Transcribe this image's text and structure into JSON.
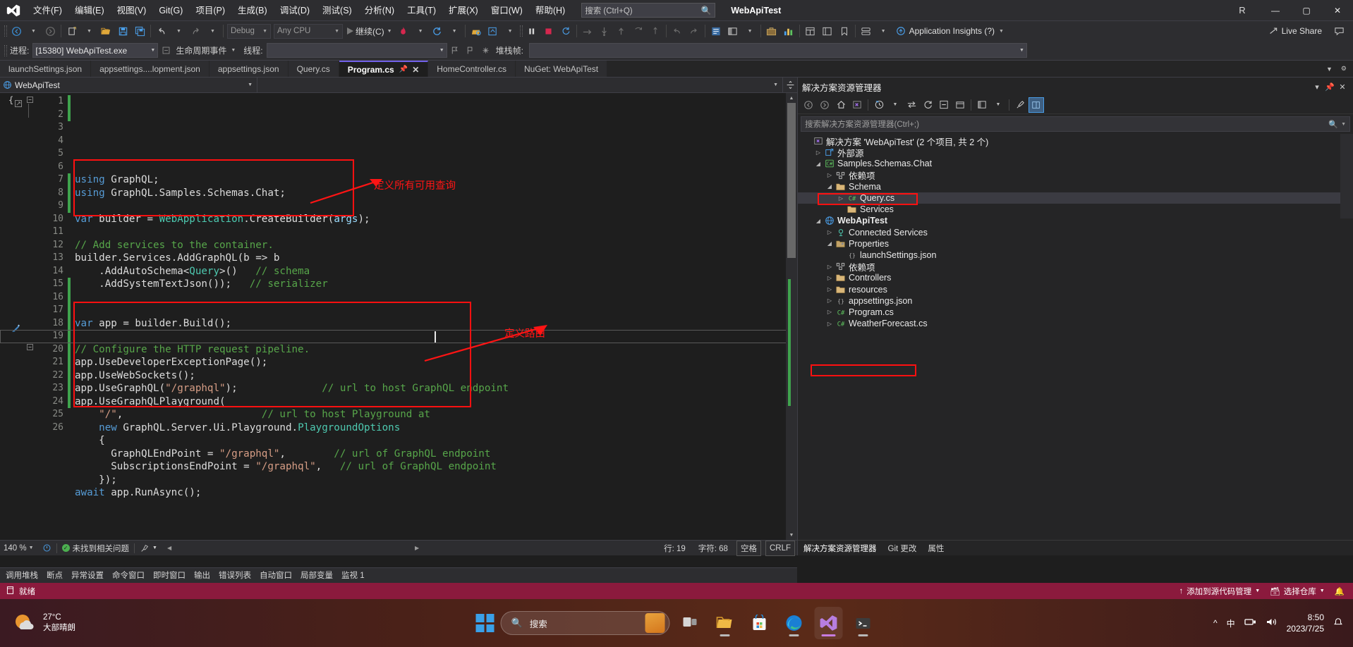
{
  "titlebar": {
    "menus": [
      "文件(F)",
      "编辑(E)",
      "视图(V)",
      "Git(G)",
      "项目(P)",
      "生成(B)",
      "调试(D)",
      "测试(S)",
      "分析(N)",
      "工具(T)",
      "扩展(X)",
      "窗口(W)",
      "帮助(H)"
    ],
    "search_placeholder": "搜索 (Ctrl+Q)",
    "project_name": "WebApiTest",
    "account_initial": "R",
    "minimize": "—",
    "maximize": "▢",
    "close": "✕"
  },
  "toolbar": {
    "config": "Debug",
    "platform": "Any CPU",
    "run_label": "继续(C)",
    "ai_label": "Application Insights (?)",
    "live_share": "Live Share"
  },
  "debugbar": {
    "process_label": "进程:",
    "process_value": "[15380] WebApiTest.exe",
    "lifecycle_label": "生命周期事件",
    "thread_label": "线程:",
    "thread_value": "",
    "stack_label": "堆栈帧:",
    "stack_value": ""
  },
  "tabs": [
    {
      "label": "launchSettings.json",
      "active": false
    },
    {
      "label": "appsettings....lopment.json",
      "active": false
    },
    {
      "label": "appsettings.json",
      "active": false
    },
    {
      "label": "Query.cs",
      "active": false
    },
    {
      "label": "Program.cs",
      "active": true
    },
    {
      "label": "HomeController.cs",
      "active": false
    },
    {
      "label": "NuGet: WebApiTest",
      "active": false
    }
  ],
  "navbar": {
    "scope": "WebApiTest"
  },
  "editor": {
    "line_numbers": [
      "1",
      "2",
      "3",
      "4",
      "5",
      "6",
      "7",
      "8",
      "9",
      "10",
      "11",
      "12",
      "13",
      "14",
      "15",
      "16",
      "17",
      "18",
      "19",
      "20",
      "21",
      "22",
      "23",
      "24",
      "25",
      "26"
    ],
    "lines": [
      [
        {
          "t": "using ",
          "c": "kw"
        },
        {
          "t": "GraphQL;",
          "c": "txt"
        }
      ],
      [
        {
          "t": "using ",
          "c": "kw"
        },
        {
          "t": "GraphQL.Samples.Schemas.Chat;",
          "c": "txt"
        }
      ],
      [],
      [
        {
          "t": "var ",
          "c": "kw"
        },
        {
          "t": "builder = ",
          "c": "txt"
        },
        {
          "t": "WebApplication",
          "c": "type"
        },
        {
          "t": ".CreateBuilder(",
          "c": "txt"
        },
        {
          "t": "args",
          "c": "par"
        },
        {
          "t": ");",
          "c": "txt"
        }
      ],
      [],
      [
        {
          "t": "// Add services to the container.",
          "c": "cmt"
        }
      ],
      [
        {
          "t": "builder.Services.AddGraphQL(b => b",
          "c": "txt"
        }
      ],
      [
        {
          "t": "    .AddAutoSchema<",
          "c": "txt"
        },
        {
          "t": "Query",
          "c": "type"
        },
        {
          "t": ">()   ",
          "c": "txt"
        },
        {
          "t": "// schema",
          "c": "cmt"
        }
      ],
      [
        {
          "t": "    .AddSystemTextJson());   ",
          "c": "txt"
        },
        {
          "t": "// serializer",
          "c": "cmt"
        }
      ],
      [],
      [],
      [
        {
          "t": "var ",
          "c": "kw"
        },
        {
          "t": "app = builder.Build();",
          "c": "txt"
        }
      ],
      [],
      [
        {
          "t": "// Configure the HTTP request pipeline.",
          "c": "cmt"
        }
      ],
      [
        {
          "t": "app.UseDeveloperExceptionPage();",
          "c": "txt"
        }
      ],
      [
        {
          "t": "app.UseWebSockets();",
          "c": "txt"
        }
      ],
      [
        {
          "t": "app.UseGraphQL(",
          "c": "txt"
        },
        {
          "t": "\"/graphql\"",
          "c": "str"
        },
        {
          "t": ");              ",
          "c": "txt"
        },
        {
          "t": "// url to host GraphQL endpoint",
          "c": "cmt"
        }
      ],
      [
        {
          "t": "app.UseGraphQLPlayground(",
          "c": "txt"
        }
      ],
      [
        {
          "t": "    ",
          "c": "txt"
        },
        {
          "t": "\"/\"",
          "c": "str"
        },
        {
          "t": ",                       ",
          "c": "txt"
        },
        {
          "t": "// url to host Playground at",
          "c": "cmt"
        }
      ],
      [
        {
          "t": "    ",
          "c": "txt"
        },
        {
          "t": "new ",
          "c": "kw"
        },
        {
          "t": "GraphQL.Server.Ui.Playground.",
          "c": "txt"
        },
        {
          "t": "PlaygroundOptions",
          "c": "type"
        }
      ],
      [
        {
          "t": "    {",
          "c": "txt"
        }
      ],
      [
        {
          "t": "      GraphQLEndPoint = ",
          "c": "txt"
        },
        {
          "t": "\"/graphql\"",
          "c": "str"
        },
        {
          "t": ",        ",
          "c": "txt"
        },
        {
          "t": "// url of GraphQL endpoint",
          "c": "cmt"
        }
      ],
      [
        {
          "t": "      SubscriptionsEndPoint = ",
          "c": "txt"
        },
        {
          "t": "\"/graphql\"",
          "c": "str"
        },
        {
          "t": ",   ",
          "c": "txt"
        },
        {
          "t": "// url of GraphQL endpoint",
          "c": "cmt"
        }
      ],
      [
        {
          "t": "    });",
          "c": "txt"
        }
      ],
      [
        {
          "t": "await ",
          "c": "kw"
        },
        {
          "t": "app.RunAsync();",
          "c": "txt"
        }
      ],
      []
    ]
  },
  "annotations": [
    {
      "text": "定义所有可用查询",
      "color": "#ff1414"
    },
    {
      "text": "定义路由",
      "color": "#ff1414"
    }
  ],
  "editor_status": {
    "zoom": "140 %",
    "issues": "未找到相关问题",
    "line": "行: 19",
    "col": "字符: 68",
    "spaces": "空格",
    "eol": "CRLF"
  },
  "bottom_tabs": [
    "调用堆栈",
    "断点",
    "异常设置",
    "命令窗口",
    "即时窗口",
    "输出",
    "错误列表",
    "自动窗口",
    "局部变量",
    "监视 1"
  ],
  "solution_explorer": {
    "title": "解决方案资源管理器",
    "search_placeholder": "搜索解决方案资源管理器(Ctrl+;)",
    "tree": [
      {
        "label": "解决方案 'WebApiTest' (2 个项目, 共 2 个)",
        "indent": 0,
        "expander": "",
        "icon": "solution",
        "bold": false,
        "selected": false,
        "boxed": false
      },
      {
        "label": "外部源",
        "indent": 1,
        "expander": "▷",
        "icon": "external",
        "bold": false,
        "selected": false,
        "boxed": false
      },
      {
        "label": "Samples.Schemas.Chat",
        "indent": 1,
        "expander": "◢",
        "icon": "csproj",
        "bold": false,
        "selected": false,
        "boxed": false
      },
      {
        "label": "依赖项",
        "indent": 2,
        "expander": "▷",
        "icon": "deps",
        "bold": false,
        "selected": false,
        "boxed": false
      },
      {
        "label": "Schema",
        "indent": 2,
        "expander": "◢",
        "icon": "folder",
        "bold": false,
        "selected": false,
        "boxed": false
      },
      {
        "label": "Query.cs",
        "indent": 3,
        "expander": "▷",
        "icon": "cs",
        "bold": false,
        "selected": true,
        "boxed": true
      },
      {
        "label": "Services",
        "indent": 3,
        "expander": "",
        "icon": "folder",
        "bold": false,
        "selected": false,
        "boxed": false
      },
      {
        "label": "WebApiTest",
        "indent": 1,
        "expander": "◢",
        "icon": "web",
        "bold": true,
        "selected": false,
        "boxed": false
      },
      {
        "label": "Connected Services",
        "indent": 2,
        "expander": "▷",
        "icon": "connected",
        "bold": false,
        "selected": false,
        "boxed": false
      },
      {
        "label": "Properties",
        "indent": 2,
        "expander": "◢",
        "icon": "props",
        "bold": false,
        "selected": false,
        "boxed": false
      },
      {
        "label": "launchSettings.json",
        "indent": 3,
        "expander": "",
        "icon": "json",
        "bold": false,
        "selected": false,
        "boxed": false
      },
      {
        "label": "依赖项",
        "indent": 2,
        "expander": "▷",
        "icon": "deps",
        "bold": false,
        "selected": false,
        "boxed": false
      },
      {
        "label": "Controllers",
        "indent": 2,
        "expander": "▷",
        "icon": "folder",
        "bold": false,
        "selected": false,
        "boxed": false
      },
      {
        "label": "resources",
        "indent": 2,
        "expander": "▷",
        "icon": "folder",
        "bold": false,
        "selected": false,
        "boxed": false
      },
      {
        "label": "appsettings.json",
        "indent": 2,
        "expander": "▷",
        "icon": "json",
        "bold": false,
        "selected": false,
        "boxed": false
      },
      {
        "label": "Program.cs",
        "indent": 2,
        "expander": "▷",
        "icon": "cs",
        "bold": false,
        "selected": false,
        "boxed": true
      },
      {
        "label": "WeatherForecast.cs",
        "indent": 2,
        "expander": "▷",
        "icon": "cs",
        "bold": false,
        "selected": false,
        "boxed": false
      }
    ],
    "footer_tabs": [
      "解决方案资源管理器",
      "Git 更改",
      "属性"
    ]
  },
  "vs_statusbar": {
    "status": "就绪",
    "source_control": "添加到源代码管理",
    "repo": "选择仓库"
  },
  "taskbar": {
    "temperature": "27°C",
    "weather_desc": "大部晴朗",
    "search_label": "搜索",
    "time": "8:50",
    "date": "2023/7/25",
    "ime": "中"
  }
}
